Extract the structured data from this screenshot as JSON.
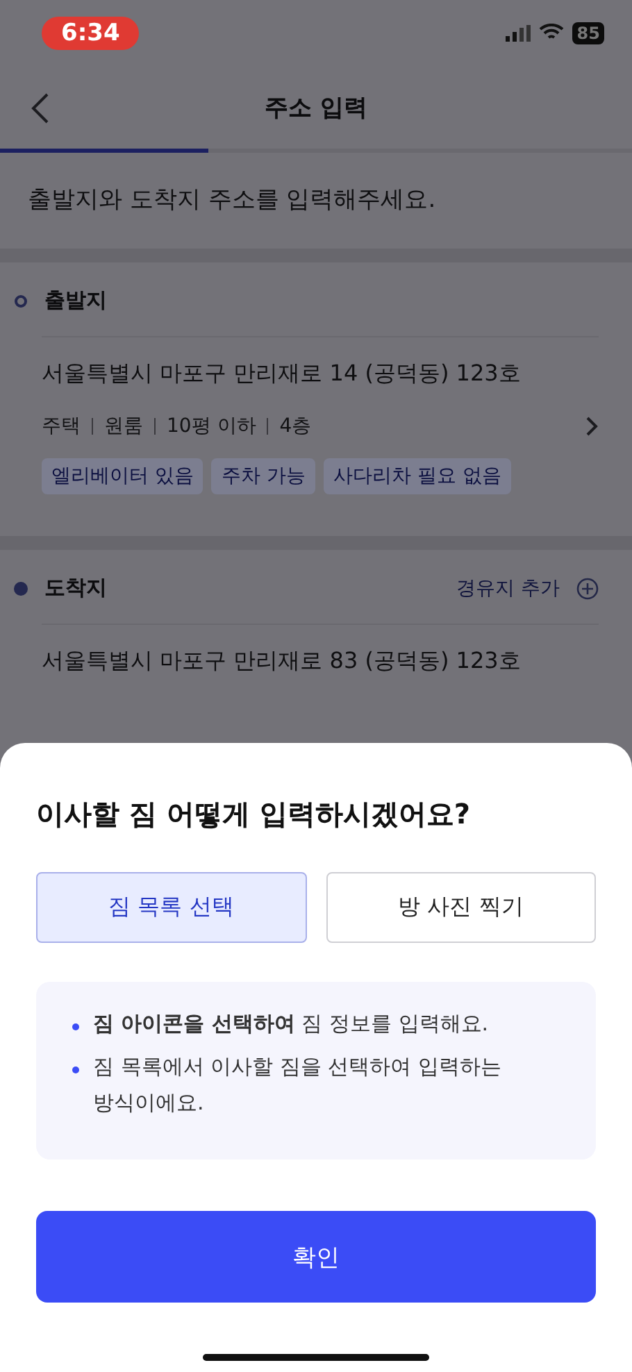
{
  "status_bar": {
    "time": "6:34",
    "battery": "85"
  },
  "header": {
    "title": "주소 입력"
  },
  "progress": {
    "level": 0.33
  },
  "subtitle": "출발지와 도착지 주소를 입력해주세요.",
  "stops": [
    {
      "kind": "origin",
      "label": "출발지",
      "address": "서울특별시 마포구 만리재로 14 (공덕동) 123호",
      "details": [
        "주택",
        "원룸",
        "10평 이하",
        "4층"
      ],
      "tags": [
        "엘리베이터 있음",
        "주차 가능",
        "사다리차 필요 없음"
      ]
    },
    {
      "kind": "destination",
      "label": "도착지",
      "action": "경유지 추가",
      "address": "서울특별시 마포구 만리재로 83 (공덕동) 123호"
    }
  ],
  "sheet": {
    "title": "이사할 짐 어떻게 입력하시겠어요?",
    "options": [
      {
        "label": "짐 목록 선택",
        "selected": true
      },
      {
        "label": "방 사진 찍기",
        "selected": false
      }
    ],
    "notes": [
      "**짐 아이콘을 선택하여** 짐 정보를 입력해요.",
      "짐 목록에서 이사할 짐을 선택하여 입력하는 방식이에요."
    ],
    "confirm": "확인"
  }
}
